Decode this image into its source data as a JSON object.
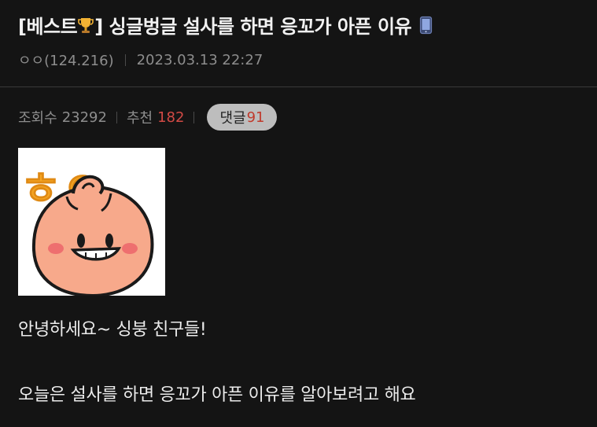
{
  "post": {
    "title_prefix": "[베스트",
    "title_suffix": "] 싱글벙글 설사를 하면 응꼬가 아픈 이유",
    "trophy_icon": "trophy-icon",
    "device_icon": "mobile-phone-icon",
    "author": "ㅇㅇ(124.216)",
    "date": "2023.03.13 22:27"
  },
  "stats": {
    "views_label": "조회수",
    "views_value": "23292",
    "recommend_label": "추천",
    "recommend_value": "182",
    "comments_label": "댓글",
    "comments_value": "91"
  },
  "content": {
    "image_text": "ㅎㅇ",
    "line1": "안녕하세요~ 싱붕 친구들!",
    "line2": "오늘은 설사를 하면 응꼬가 아픈 이유를 알아보려고 해요"
  },
  "colors": {
    "background": "#141414",
    "recommend_accent": "#d24a45",
    "comment_pill": "#bdbdbd",
    "image_text_color": "#f5a623",
    "character_face": "#f7a98b"
  }
}
